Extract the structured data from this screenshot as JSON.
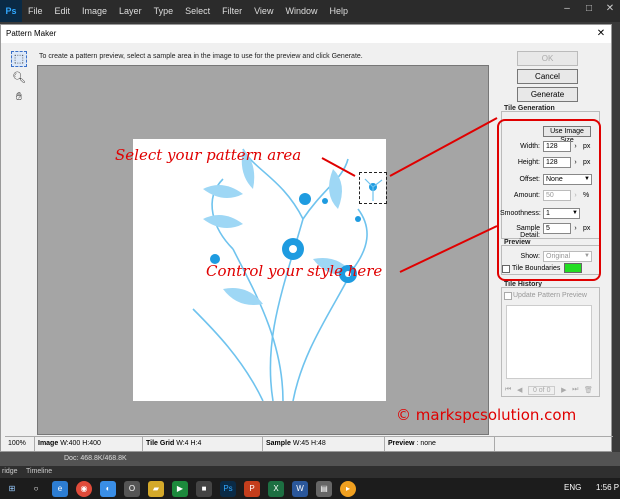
{
  "menubar": {
    "logo": "Ps",
    "items": [
      "File",
      "Edit",
      "Image",
      "Layer",
      "Type",
      "Select",
      "Filter",
      "View",
      "Window",
      "Help"
    ]
  },
  "dialog": {
    "title": "Pattern Maker",
    "instruction": "To create a pattern preview, select a sample area in the image to use for the preview and click Generate.",
    "buttons": {
      "ok": "OK",
      "cancel": "Cancel",
      "generate": "Generate"
    }
  },
  "tile_generation": {
    "title": "Tile Generation",
    "use_image_size": "Use Image Size",
    "width_label": "Width:",
    "width_value": "128",
    "width_unit": "px",
    "height_label": "Height:",
    "height_value": "128",
    "height_unit": "px",
    "offset_label": "Offset:",
    "offset_value": "None",
    "amount_label": "Amount:",
    "amount_value": "50",
    "amount_unit": "%",
    "smoothness_label": "Smoothness:",
    "smoothness_value": "1",
    "sample_detail_label": "Sample Detail:",
    "sample_detail_value": "5",
    "sample_detail_unit": "px"
  },
  "preview": {
    "title": "Preview",
    "show_label": "Show:",
    "show_value": "Original",
    "tile_boundaries_label": "Tile Boundaries",
    "tile_boundaries_color": "#22dd22"
  },
  "tile_history": {
    "title": "Tile History",
    "update_label": "Update Pattern Preview",
    "counter": "0 of 0"
  },
  "status": {
    "zoom": "100%",
    "image_label": "Image",
    "image_value": "W:400 H:400",
    "tilegrid_label": "Tile Grid",
    "tilegrid_value": "W:4 H:4",
    "sample_label": "Sample",
    "sample_value": "W:45 H:48",
    "preview_label": "Preview",
    "preview_value": "none"
  },
  "annotations": {
    "select_area": "Select your pattern area",
    "control_style": "Control your style here",
    "watermark": "© markspcsolution.com",
    "color": "#e00000"
  },
  "doc_info": "Doc: 468.8K/468.8K",
  "tabs": [
    "ridge",
    "Timeline"
  ],
  "taskbar": {
    "language": "ENG",
    "time": "1:56 P"
  }
}
